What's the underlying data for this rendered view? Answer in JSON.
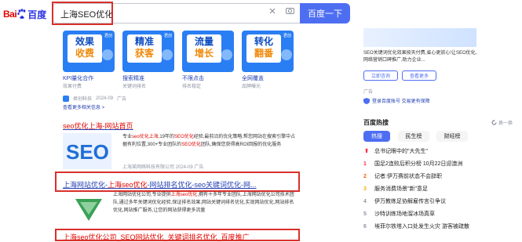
{
  "logo": {
    "part1": "Bai",
    "part2": "百度"
  },
  "search": {
    "query": "上海SEO优化",
    "button": "百度一下"
  },
  "ads": [
    {
      "line1": "效果",
      "line2": "收费",
      "brand": "君创",
      "label": "KPI量化合作",
      "sub": "效果付费"
    },
    {
      "line1": "精准",
      "line2": "获客",
      "brand": "君创",
      "label": "搜索精准",
      "sub": "关键词排名"
    },
    {
      "line1": "流量",
      "line2": "增长",
      "brand": "",
      "label": "不限点击",
      "sub": "排名稳定"
    },
    {
      "line1": "转化",
      "line2": "翻番",
      "brand": "君创",
      "label": "全网覆盖",
      "sub": "品牌曝光"
    }
  ],
  "ad_meta": {
    "company": "君创科技",
    "date": "2024-09",
    "tag": "广告",
    "more": "查看更多相关信息 >"
  },
  "results": [
    {
      "title": "seo优化上海-网站首页",
      "snippet": [
        {
          "t": "专业"
        },
        {
          "t": "seo优化上海",
          "red": true
        },
        {
          "t": ",19年的"
        },
        {
          "t": "SEO优化",
          "red": true
        },
        {
          "t": "经验,最前沿的优化策略,帮您网站在搜"
        },
        {
          "t": "索引擎中占据有利位置,300+专业团队的"
        },
        {
          "t": "SEO优化",
          "red": true
        },
        {
          "t": "团队,确保您获得高ROI回"
        },
        {
          "t": "报的优化服务"
        }
      ],
      "meta": "上海某网络科技有限公司  2024-09  广告"
    },
    {
      "title_parts": [
        {
          "t": "上海网站优化-"
        },
        {
          "t": "上海seo优化",
          "red": true
        },
        {
          "t": "-网站排名优化-seo关键词优化-网..."
        }
      ],
      "snippet": [
        {
          "t": "上海网站优化公司,专业提供"
        },
        {
          "t": "上海seo优化",
          "red": true
        },
        {
          "t": ",拥有十多年专业团队,上海网站优化公司技术团队,通过多年关键词优化经验,保证排名效果,网站关键词排名优化,实现网站优化,网站排名优化,网站推广服务,让您的网站获得更多流量"
        }
      ]
    },
    {
      "title": "上海seo优化公司_SEO网站优化_关键词排名优化_百度推广"
    }
  ],
  "right": {
    "desc": "SEO关键词优化效果按天付费,省心更放心!让SEO优化,网络营销口碑推广,助力企业...",
    "pills": [
      "立即咨询",
      "查看更多"
    ],
    "ad_tag": "广告",
    "login": "登录百度账号 交易更有保障",
    "hot_title": "百度热搜",
    "refresh": "换一换",
    "tabs": [
      "热搜",
      "民生榜",
      "财经榜"
    ],
    "hot": [
      {
        "rank": "",
        "text": "总书记眼中的\"大先生\"",
        "badge": ""
      },
      {
        "rank": "1",
        "text": "国足2连败后积分榜 10月22日迎澳洲",
        "badge": ""
      },
      {
        "rank": "2",
        "text": "记者:伊万赛前状态不会辞职",
        "badge": ""
      },
      {
        "rank": "3",
        "text": "服务消费场景\"新\"意足",
        "badge": ""
      },
      {
        "rank": "4",
        "text": "伊万教练足协解雇传言引争议",
        "badge": ""
      },
      {
        "rank": "5",
        "text": "沙特训练场地溜冰场真草",
        "badge": ""
      },
      {
        "rank": "6",
        "text": "埃菲尔铁塔入口处发生火灾 游客被疏散",
        "badge": ""
      }
    ]
  }
}
